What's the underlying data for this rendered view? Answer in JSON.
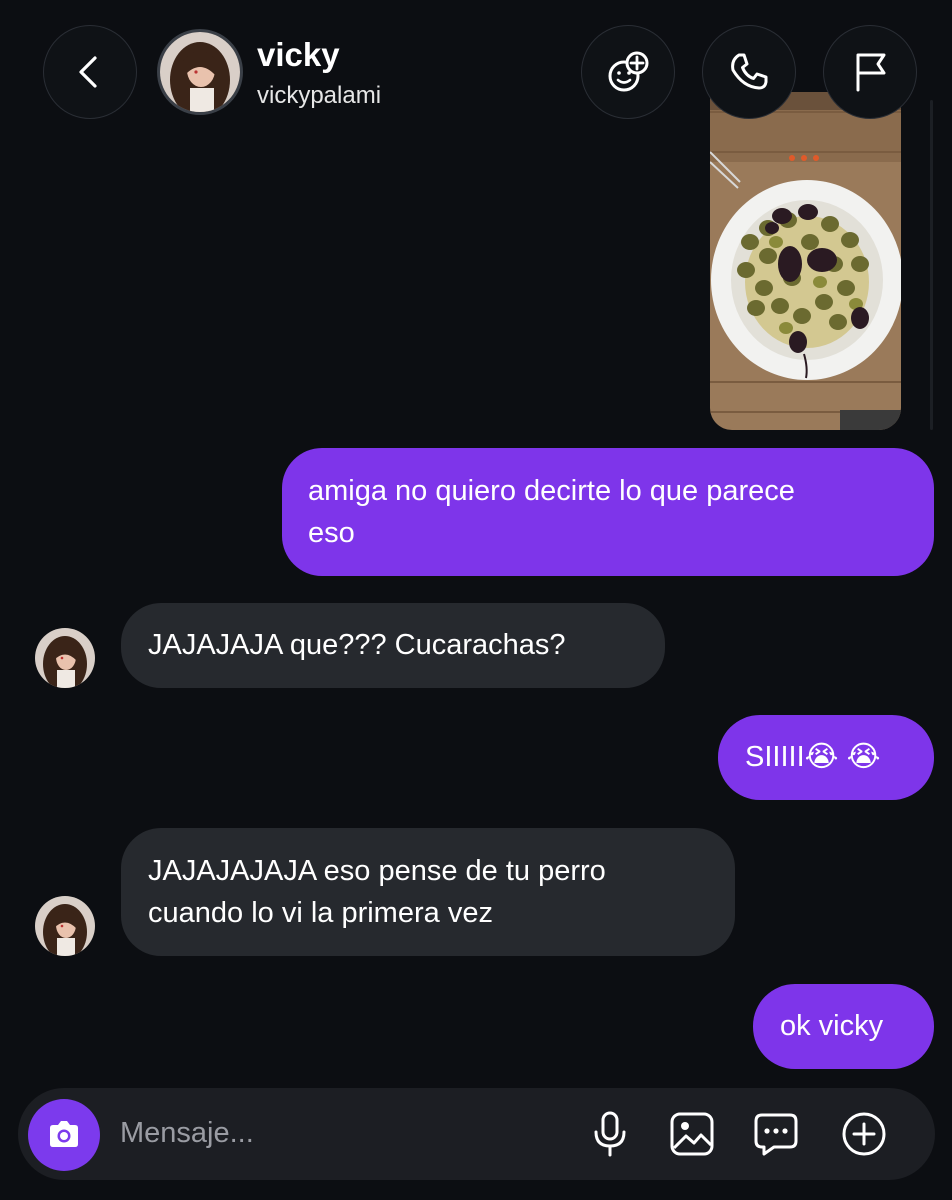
{
  "header": {
    "name": "vicky",
    "username": "vickypalami"
  },
  "messages": [
    {
      "direction": "outgoing",
      "text": "amiga no quiero decirte lo que parece\neso"
    },
    {
      "direction": "incoming",
      "text": "JAJAJAJA que??? Cucarachas?"
    },
    {
      "direction": "outgoing",
      "text": "SIIIII😭 😭"
    },
    {
      "direction": "incoming",
      "text": "JAJAJAJAJA eso pense de tu perro\ncuando lo vi la primera vez"
    },
    {
      "direction": "outgoing",
      "text": "ok vicky"
    }
  ],
  "composer": {
    "placeholder": "Mensaje..."
  },
  "icons": {
    "back": "chevron-left-icon",
    "new_chat": "new-chat-icon",
    "call": "phone-icon",
    "report": "flag-icon",
    "camera": "camera-icon",
    "mic": "microphone-icon",
    "gallery": "gallery-icon",
    "sticker": "sticker-icon",
    "plus": "plus-icon"
  },
  "colors": {
    "background": "#0c0e12",
    "outgoing_bubble": "#7e35ea",
    "incoming_bubble": "#26292e",
    "composer": "#1c1e23",
    "camera_button": "#7c3aed"
  }
}
